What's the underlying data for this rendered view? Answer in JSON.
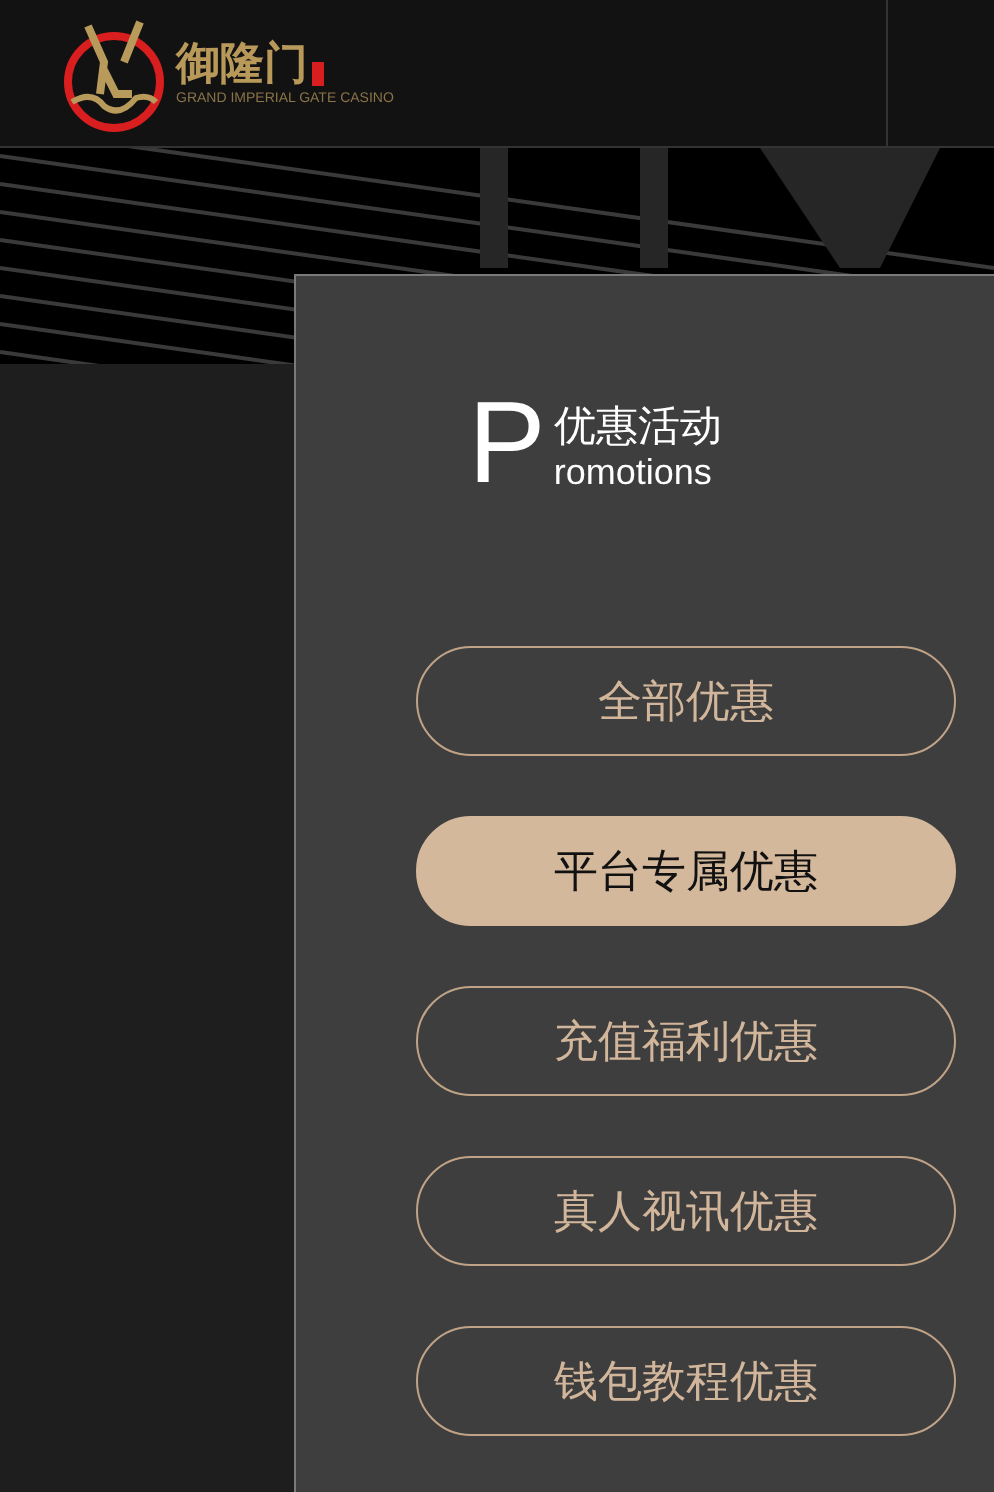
{
  "header": {
    "logo_name": "御隆门",
    "logo_tagline": "GRAND IMPERIAL GATE CASINO"
  },
  "promotions": {
    "letter": "P",
    "title": "优惠活动",
    "subtitle": "romotions",
    "categories": [
      {
        "label": "全部优惠",
        "selected": false
      },
      {
        "label": "平台专属优惠",
        "selected": true
      },
      {
        "label": "充值福利优惠",
        "selected": false
      },
      {
        "label": "真人视讯优惠",
        "selected": false
      },
      {
        "label": "钱包教程优惠",
        "selected": false
      }
    ]
  }
}
